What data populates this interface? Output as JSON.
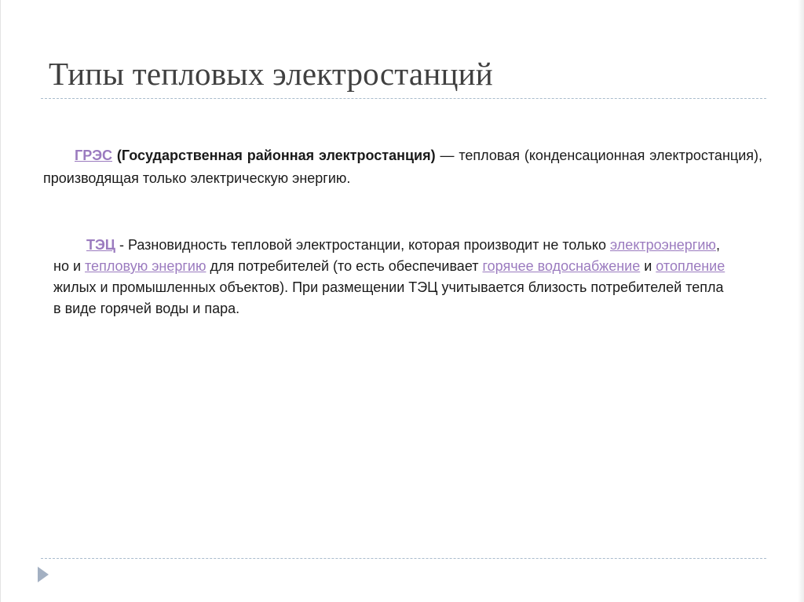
{
  "slide": {
    "title": "Типы тепловых электростанций",
    "paragraph1": {
      "term": "ГРЭС",
      "space1": " ",
      "expansion": "(Государственная районная электростанция)",
      "rest": " — тепловая (конденсационная электростанция), производящая только электрическую энергию."
    },
    "paragraph2": {
      "term": "ТЭЦ",
      "text1": " - Разновидность тепловой электростанции, которая производит не только ",
      "link1": "электроэнергию",
      "text2": ", но и ",
      "link2": "тепловую энергию",
      "text3": " для потребителей (то есть обеспечивает ",
      "link3": "горячее водоснабжение",
      "text4": " и ",
      "link4": "отопление",
      "text5": " жилых и промышленных объектов). При размещении ТЭЦ учитывается близость потребителей тепла в виде горячей воды и пара."
    }
  },
  "colors": {
    "title": "#404040",
    "text": "#1a1a1a",
    "link": "#9b7bbf",
    "rule": "#a9bccd",
    "nav_arrow": "#a3b0c2"
  },
  "icons": {
    "nav": "triangle-right-icon"
  }
}
